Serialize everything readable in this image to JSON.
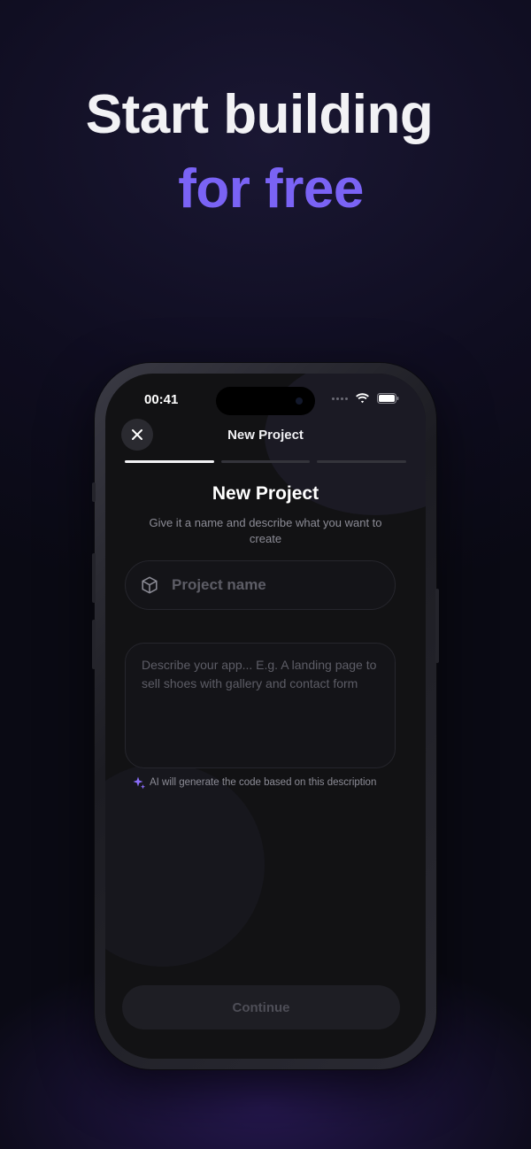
{
  "hero": {
    "line1": "Start building",
    "line2": "for free"
  },
  "status_bar": {
    "time": "00:41"
  },
  "nav": {
    "title": "New Project"
  },
  "progress": {
    "steps_total": 3,
    "current_step": 1
  },
  "form": {
    "title": "New Project",
    "subtitle": "Give it a name and describe what you want to create",
    "name_placeholder": "Project name",
    "name_value": "",
    "description_placeholder": "Describe your app... E.g. A landing page to sell shoes with gallery and contact form",
    "description_value": "",
    "ai_hint": "AI will generate the code based on this description",
    "continue_label": "Continue"
  },
  "icons": {
    "close": "close-icon",
    "cube": "cube-icon",
    "sparkle": "sparkle-icon",
    "wifi": "wifi-icon",
    "battery": "battery-icon"
  },
  "colors": {
    "accent": "#7a63f5",
    "background": "#0f0d20",
    "screen": "#121214"
  }
}
